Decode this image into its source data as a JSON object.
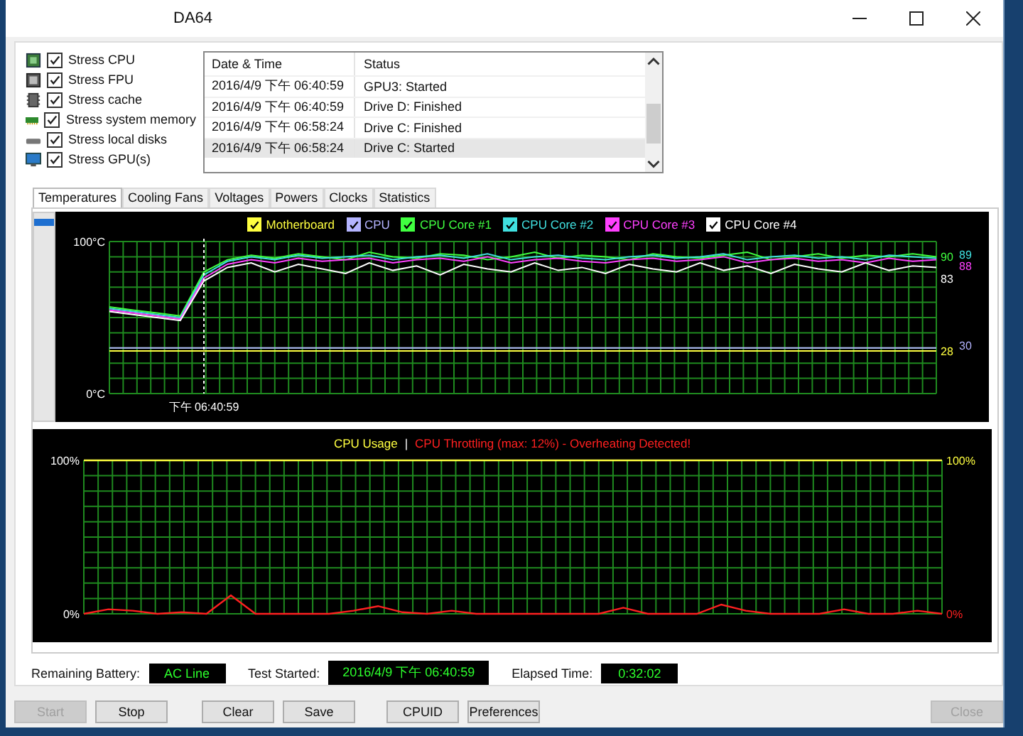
{
  "window": {
    "title": "DA64"
  },
  "stress_options": [
    {
      "label": "Stress CPU",
      "checked": true,
      "kind": "cpu"
    },
    {
      "label": "Stress FPU",
      "checked": true,
      "kind": "fpu"
    },
    {
      "label": "Stress cache",
      "checked": true,
      "kind": "cache"
    },
    {
      "label": "Stress system memory",
      "checked": true,
      "kind": "memory"
    },
    {
      "label": "Stress local disks",
      "checked": true,
      "kind": "disk"
    },
    {
      "label": "Stress GPU(s)",
      "checked": true,
      "kind": "gpu"
    }
  ],
  "log": {
    "columns": [
      "Date & Time",
      "Status"
    ],
    "rows": [
      {
        "date_time": "2016/4/9 下午 06:40:59",
        "status": "GPU3: Started",
        "selected": false
      },
      {
        "date_time": "2016/4/9 下午 06:40:59",
        "status": "Drive D: Finished",
        "selected": false
      },
      {
        "date_time": "2016/4/9 下午 06:58:24",
        "status": "Drive C: Finished",
        "selected": false
      },
      {
        "date_time": "2016/4/9 下午 06:58:24",
        "status": "Drive C: Started",
        "selected": true
      }
    ]
  },
  "tabs": [
    {
      "label": "Temperatures",
      "selected": true
    },
    {
      "label": "Cooling Fans",
      "selected": false
    },
    {
      "label": "Voltages",
      "selected": false
    },
    {
      "label": "Powers",
      "selected": false
    },
    {
      "label": "Clocks",
      "selected": false
    },
    {
      "label": "Statistics",
      "selected": false
    }
  ],
  "temperature_chart": {
    "legend_checked": [
      true,
      true,
      true,
      true,
      true,
      true
    ],
    "marker_label": "下午 06:40:59",
    "end_labels": [
      "90",
      "89",
      "88",
      "83",
      "28",
      "30"
    ],
    "chart_data": {
      "type": "line",
      "categories": [
        null,
        null,
        null,
        null,
        null,
        null,
        null,
        null,
        null,
        null,
        null,
        null,
        null,
        null,
        null,
        null,
        null,
        null,
        null,
        null,
        null,
        null,
        null,
        null,
        null,
        null,
        null,
        null,
        null,
        null,
        null,
        null,
        null,
        null,
        null,
        null
      ],
      "grid": true,
      "legend": "top",
      "ylim": [
        0,
        100
      ],
      "yticks": [
        {
          "value": 100,
          "label": "100°C"
        },
        {
          "value": 0,
          "label": "0°C"
        }
      ],
      "series": [
        {
          "name": "Motherboard",
          "color": "#ffff40",
          "values": [
            28,
            28,
            28,
            28,
            28,
            28,
            28,
            28,
            28,
            28,
            28,
            28,
            28,
            28,
            28,
            28,
            28,
            28,
            28,
            28,
            28,
            28,
            28,
            28,
            28,
            28,
            28,
            28,
            28,
            28,
            28,
            28,
            28,
            28,
            28,
            28
          ]
        },
        {
          "name": "CPU",
          "color": "#b4b4ff",
          "values": [
            30,
            30,
            30,
            30,
            30,
            30,
            30,
            30,
            30,
            30,
            30,
            30,
            30,
            30,
            30,
            30,
            30,
            30,
            30,
            30,
            30,
            30,
            30,
            30,
            30,
            30,
            30,
            30,
            30,
            30,
            30,
            30,
            30,
            30,
            30,
            30
          ]
        },
        {
          "name": "CPU Core #1",
          "color": "#40ff40",
          "values": [
            57,
            55,
            53,
            51,
            80,
            88,
            91,
            89,
            92,
            90,
            88,
            93,
            90,
            89,
            92,
            91,
            88,
            90,
            93,
            89,
            91,
            90,
            88,
            92,
            90,
            89,
            91,
            93,
            88,
            90,
            92,
            89,
            91,
            90,
            92,
            90
          ]
        },
        {
          "name": "CPU Core #2",
          "color": "#40e0e0",
          "values": [
            56,
            54,
            52,
            50,
            78,
            87,
            90,
            88,
            91,
            89,
            90,
            91,
            88,
            90,
            91,
            89,
            92,
            88,
            90,
            91,
            89,
            88,
            90,
            91,
            89,
            90,
            92,
            88,
            90,
            91,
            89,
            90,
            88,
            91,
            90,
            89
          ]
        },
        {
          "name": "CPU Core #3",
          "color": "#ff40ff",
          "values": [
            55,
            53,
            51,
            49,
            76,
            85,
            88,
            86,
            89,
            87,
            88,
            89,
            86,
            88,
            89,
            87,
            90,
            86,
            88,
            89,
            87,
            86,
            88,
            89,
            87,
            88,
            90,
            86,
            88,
            89,
            87,
            88,
            86,
            89,
            87,
            88
          ]
        },
        {
          "name": "CPU Core #4",
          "color": "#ffffff",
          "values": [
            54,
            52,
            50,
            48,
            74,
            83,
            86,
            80,
            85,
            82,
            79,
            86,
            81,
            84,
            78,
            85,
            82,
            80,
            86,
            81,
            83,
            79,
            85,
            82,
            80,
            86,
            81,
            84,
            79,
            85,
            82,
            80,
            86,
            81,
            84,
            83
          ]
        }
      ]
    }
  },
  "usage_chart": {
    "separator": "|",
    "end_labels": [
      "100%",
      "0%"
    ],
    "chart_data": {
      "type": "line",
      "categories": [
        null,
        null,
        null,
        null,
        null,
        null,
        null,
        null,
        null,
        null,
        null,
        null,
        null,
        null,
        null,
        null,
        null,
        null,
        null,
        null,
        null,
        null,
        null,
        null,
        null,
        null,
        null,
        null,
        null,
        null,
        null,
        null,
        null,
        null,
        null,
        null
      ],
      "grid": true,
      "legend": "top",
      "ylim": [
        0,
        100
      ],
      "yticks": [
        {
          "value": 100,
          "label": "100%"
        },
        {
          "value": 0,
          "label": "0%"
        }
      ],
      "series": [
        {
          "name": "CPU Usage",
          "color": "#ffff40",
          "values": [
            100,
            100,
            100,
            100,
            100,
            100,
            100,
            100,
            100,
            100,
            100,
            100,
            100,
            100,
            100,
            100,
            100,
            100,
            100,
            100,
            100,
            100,
            100,
            100,
            100,
            100,
            100,
            100,
            100,
            100,
            100,
            100,
            100,
            100,
            100,
            100
          ]
        },
        {
          "name": "CPU Throttling (max: 12%) - Overheating Detected!",
          "color": "#ff2020",
          "values": [
            0,
            3,
            2,
            0,
            1,
            0,
            12,
            0,
            0,
            0,
            0,
            2,
            5,
            1,
            0,
            2,
            0,
            0,
            0,
            0,
            0,
            0,
            4,
            0,
            0,
            0,
            6,
            2,
            0,
            0,
            0,
            3,
            0,
            0,
            2,
            0
          ]
        }
      ]
    }
  },
  "status": [
    {
      "label": "Remaining Battery:",
      "value": "AC Line"
    },
    {
      "label": "Test Started:",
      "value": "2016/4/9 下午 06:40:59"
    },
    {
      "label": "Elapsed Time:",
      "value": "0:32:02"
    }
  ],
  "buttons": [
    {
      "label": "Start",
      "disabled": true
    },
    {
      "label": "Stop",
      "disabled": false
    },
    {
      "label": "Clear",
      "disabled": false
    },
    {
      "label": "Save",
      "disabled": false
    },
    {
      "label": "CPUID",
      "disabled": false
    },
    {
      "label": "Preferences",
      "disabled": false
    },
    {
      "label": "Close",
      "disabled": true
    }
  ]
}
